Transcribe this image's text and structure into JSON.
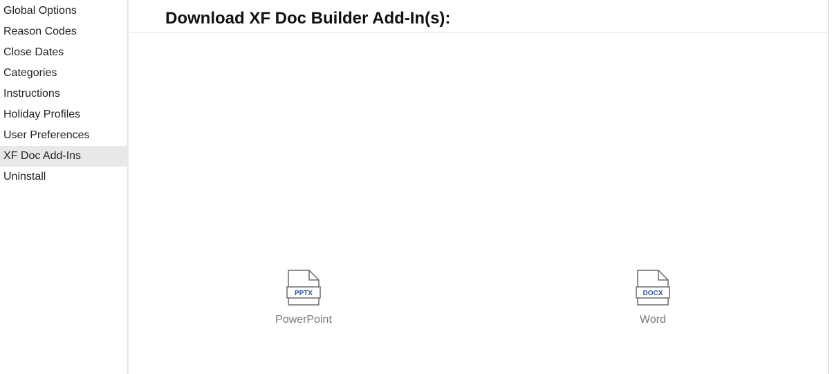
{
  "sidebar": {
    "items": [
      {
        "label": "Global Options"
      },
      {
        "label": "Reason Codes"
      },
      {
        "label": "Close Dates"
      },
      {
        "label": "Categories"
      },
      {
        "label": "Instructions"
      },
      {
        "label": "Holiday Profiles"
      },
      {
        "label": "User Preferences"
      },
      {
        "label": "XF Doc Add-Ins",
        "active": true
      },
      {
        "label": "Uninstall"
      }
    ]
  },
  "main": {
    "title": "Download XF Doc Builder Add-In(s):",
    "downloads": [
      {
        "badge": "PPTX",
        "label": "PowerPoint",
        "icon": "pptx-file-icon"
      },
      {
        "badge": "DOCX",
        "label": "Word",
        "icon": "docx-file-icon"
      }
    ]
  },
  "colors": {
    "active_item_bg": "#e8e8e8",
    "badge_text": "#2b5a9c",
    "label_text": "#7a7a7a"
  }
}
